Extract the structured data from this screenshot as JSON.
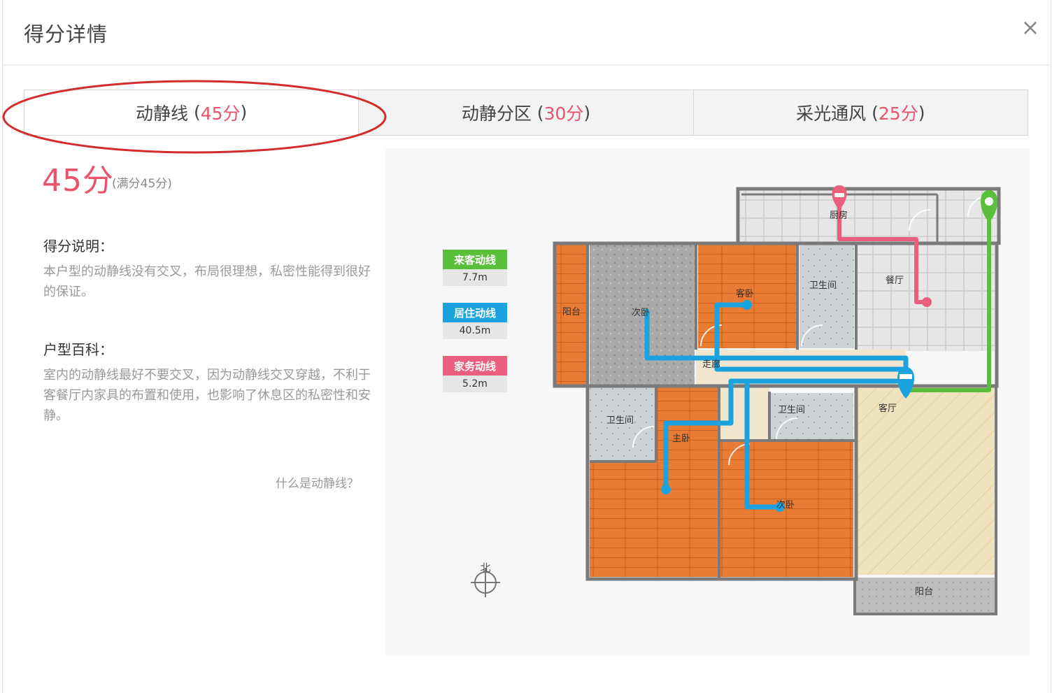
{
  "dialog": {
    "title": "得分详情",
    "close_symbol": "×"
  },
  "tabs": [
    {
      "label": "动静线",
      "score": "45分",
      "active": true
    },
    {
      "label": "动静分区",
      "score": "30分",
      "active": false
    },
    {
      "label": "采光通风",
      "score": "25分",
      "active": false
    }
  ],
  "score": {
    "value": "45分",
    "full": "(满分45分)"
  },
  "explanation": {
    "title": "得分说明：",
    "text": "本户型的动静线没有交叉，布局很理想，私密性能得到很好的保证。"
  },
  "wiki": {
    "title": "户型百科：",
    "text": "室内的动静线最好不要交叉，因为动静线交叉穿越，不利于客餐厅内家具的布置和使用，也影响了休息区的私密性和安静。"
  },
  "help_link": "什么是动静线？",
  "legend": [
    {
      "label": "来客动线",
      "value": "7.7m",
      "color": "#5bbf3c"
    },
    {
      "label": "居住动线",
      "value": "40.5m",
      "color": "#1aa3df"
    },
    {
      "label": "家务动线",
      "value": "5.2m",
      "color": "#ea5f7d"
    }
  ],
  "rooms": {
    "kitchen": "厨房",
    "dining": "餐厅",
    "balcony_west": "阳台",
    "second_bed_north": "次卧",
    "guest_bed": "客卧",
    "bath_north": "卫生间",
    "corridor": "走廊",
    "living": "客厅",
    "bath_west": "卫生间",
    "master_bed": "主卧",
    "bath_middle": "卫生间",
    "second_bed_south": "次卧",
    "balcony_south": "阳台"
  },
  "compass": {
    "label": "北"
  },
  "colors": {
    "accent": "#e9546b",
    "guest_line": "#5bbf3c",
    "living_line": "#1aa3df",
    "chore_line": "#ea5f7d"
  }
}
